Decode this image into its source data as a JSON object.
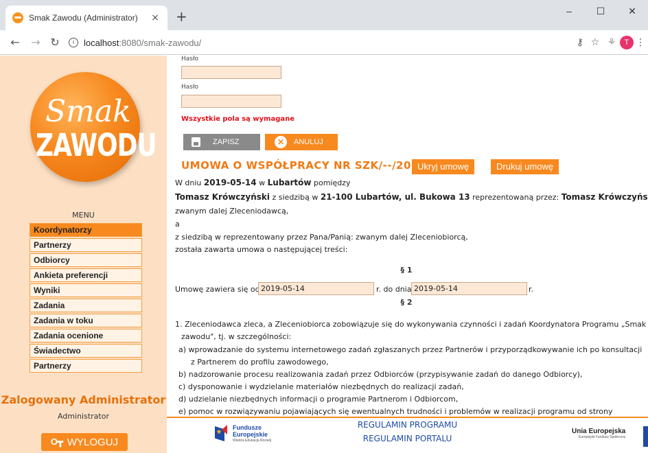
{
  "browser": {
    "tab_title": "Smak Zawodu (Administrator)",
    "tab_close": "×",
    "new_tab": "+",
    "url_host": "localhost",
    "url_rest": ":8080/smak-zawodu/",
    "profile_initial": "T",
    "win_minimize": "–",
    "win_maximize": "☐",
    "win_close": "✕"
  },
  "sidebar": {
    "logo_top": "Smak",
    "logo_bottom": "ZAWODU",
    "menu_title": "MENU",
    "items": [
      {
        "label": "Koordynatorzy",
        "active": true
      },
      {
        "label": "Partnerzy"
      },
      {
        "label": "Odbiorcy"
      },
      {
        "label": "Ankieta preferencji"
      },
      {
        "label": "Wyniki"
      },
      {
        "label": "Zadania"
      },
      {
        "label": "Zadania w toku"
      },
      {
        "label": "Zadania ocenione"
      },
      {
        "label": "Świadectwo"
      },
      {
        "label": "Partnerzy"
      }
    ],
    "logged_label": "Zalogowany Administrator",
    "logged_user": "Administrator",
    "logout_label": "WYLOGUJ"
  },
  "form": {
    "password_label_1": "Hasło",
    "password_label_2": "Hasło",
    "required_note": "Wszystkie pola są wymagane",
    "save_label": "ZAPISZ",
    "cancel_label": "ANULUJ"
  },
  "contract": {
    "heading": "UMOWA O WSPÓŁPRACY NR SZK/--/2019",
    "hide_button": "Ukryj umowę",
    "print_button": "Drukuj umowę",
    "line1_a": "W dniu ",
    "line1_date": "2019-05-14",
    "line1_b": " w ",
    "line1_city": "Lubartów",
    "line1_c": " pomiędzy",
    "line2_name": "Tomasz Krówczyński",
    "line2_a": " z siedzibą w ",
    "line2_addr": "21-100 Lubartów, ul. Bukowa 13",
    "line2_b": " reprezentowaną przez: ",
    "line2_rep": "Tomasz Krówczyński",
    "line3": "zwanym dalej Zleceniodawcą,",
    "line4": "a",
    "line5": "z siedzibą w reprezentowany przez Pana/Panią: zwanym dalej Zleceniobiorcą,",
    "line6": "została zawarta umowa o następującej treści:",
    "section1": "§ 1",
    "term_a": "Umowę zawiera się od",
    "date_from": "2019-05-14",
    "term_b": "r. do dnia",
    "date_to": "2019-05-14",
    "term_c": "r.",
    "section2": "§ 2",
    "p1_line1": "1. Zleceniodawca zleca, a Zleceniobiorca zobowiązuje się do wykonywania czynności i zadań Koordynatora Programu „Smak",
    "p1_line2": "zawodu\", tj. w szczególności:",
    "a_line1": "a) wprowadzanie do systemu internetowego zadań zgłaszanych przez Partnerów i przyporządkowywanie ich po konsultacji",
    "a_line2": "z Partnerem do profilu zawodowego,",
    "b": "b) nadzorowanie procesu realizowania zadań przez Odbiorców (przypisywanie zadań do danego Odbiorcy),",
    "c": "c) dysponowanie i wydzielanie materiałów niezbędnych do realizacji zadań,",
    "d": "d) udzielanie niezbędnych informacji o programie Partnerom i Odbiorcom,",
    "e": "e) pomoc w rozwiązywaniu pojawiających się ewentualnych trudności i problemów w realizacji programu od strony"
  },
  "footer": {
    "funds_line1": "Fundusze",
    "funds_line2": "Europejskie",
    "funds_line3": "Wiedza Edukacja Rozwój",
    "reg_program": "REGULAMIN PROGRAMU",
    "reg_portal": "REGULAMIN PORTALU",
    "ue_title": "Unia Europejska",
    "ue_sub": "Europejski Fundusz Społeczny"
  },
  "colors": {
    "accent": "#f7891f",
    "sidebar_bg": "#fde0c4",
    "link_blue": "#1e4aa8",
    "error_red": "#e0101a"
  }
}
